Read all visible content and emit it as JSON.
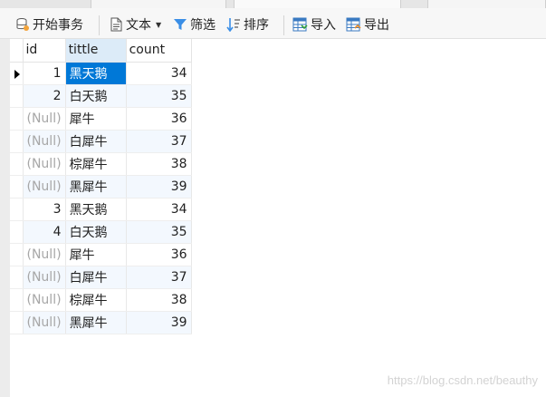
{
  "toolbar": {
    "begin_transaction": "开始事务",
    "text": "文本",
    "filter": "筛选",
    "sort": "排序",
    "import": "导入",
    "export": "导出"
  },
  "grid": {
    "columns": [
      "id",
      "tittle",
      "count"
    ],
    "rows": [
      {
        "id": "1",
        "tittle": "黑天鹅",
        "count": "34"
      },
      {
        "id": "2",
        "tittle": "白天鹅",
        "count": "35"
      },
      {
        "id": "(Null)",
        "tittle": "犀牛",
        "count": "36"
      },
      {
        "id": "(Null)",
        "tittle": "白犀牛",
        "count": "37"
      },
      {
        "id": "(Null)",
        "tittle": "棕犀牛",
        "count": "38"
      },
      {
        "id": "(Null)",
        "tittle": "黑犀牛",
        "count": "39"
      },
      {
        "id": "3",
        "tittle": "黑天鹅",
        "count": "34"
      },
      {
        "id": "4",
        "tittle": "白天鹅",
        "count": "35"
      },
      {
        "id": "(Null)",
        "tittle": "犀牛",
        "count": "36"
      },
      {
        "id": "(Null)",
        "tittle": "白犀牛",
        "count": "37"
      },
      {
        "id": "(Null)",
        "tittle": "棕犀牛",
        "count": "38"
      },
      {
        "id": "(Null)",
        "tittle": "黑犀牛",
        "count": "39"
      }
    ]
  },
  "watermark": "https://blog.csdn.net/beauthy",
  "colors": {
    "selection": "#0078d7",
    "null_text": "#a7a7a7",
    "alt_row": "#f3f8fe"
  }
}
